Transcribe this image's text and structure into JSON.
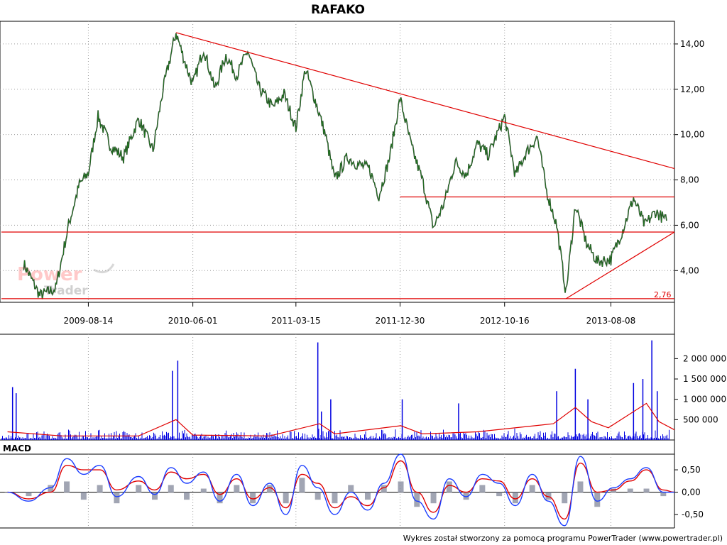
{
  "title": "RAFAKO",
  "footer": "Wykres został stworzony za pomocą programu PowerTrader (www.powertrader.pl)",
  "watermark": {
    "line1": "Power",
    "line2": "Trader"
  },
  "colors": {
    "price": "#1f7a1f",
    "trendline": "#e00000",
    "volume": "#0000e0",
    "volume_avg": "#e00000",
    "macd": "#1a3cff",
    "signal": "#e00000",
    "histogram": "#8a8fa0"
  },
  "price_panel": {
    "y_ticks": [
      "14,00",
      "12,00",
      "10,00",
      "8,00",
      "6,00",
      "4,00"
    ],
    "x_ticks": [
      "2009-08-14",
      "2010-06-01",
      "2011-03-15",
      "2011-12-30",
      "2012-10-16",
      "2013-08-08"
    ],
    "low_label": "2,76"
  },
  "volume_panel": {
    "y_ticks": [
      "2 000 000",
      "1 500 000",
      "1 000 000",
      "500 000"
    ]
  },
  "macd_panel": {
    "label": "MACD",
    "y_ticks": [
      "0,50",
      "0,00",
      "-0,50"
    ]
  },
  "chart_data": {
    "type": "line",
    "title": "RAFAKO",
    "price": {
      "ylim": [
        2.6,
        15.0
      ],
      "x": [
        "2009-02-15",
        "2009-04-01",
        "2009-05-15",
        "2009-06-20",
        "2009-07-20",
        "2009-08-14",
        "2009-09-10",
        "2009-10-15",
        "2009-11-20",
        "2010-01-01",
        "2010-02-10",
        "2010-03-10",
        "2010-04-15",
        "2010-05-10",
        "2010-06-01",
        "2010-07-01",
        "2010-08-01",
        "2010-09-01",
        "2010-10-01",
        "2010-11-01",
        "2010-12-01",
        "2011-01-10",
        "2011-02-10",
        "2011-03-15",
        "2011-04-10",
        "2011-05-10",
        "2011-06-05",
        "2011-07-01",
        "2011-08-05",
        "2011-09-01",
        "2011-10-05",
        "2011-11-01",
        "2011-12-01",
        "2011-12-30",
        "2012-02-01",
        "2012-03-01",
        "2012-04-01",
        "2012-05-01",
        "2012-06-01",
        "2012-07-01",
        "2012-08-01",
        "2012-09-01",
        "2012-10-16",
        "2012-11-15",
        "2012-12-15",
        "2013-01-15",
        "2013-02-10",
        "2013-03-10",
        "2013-04-05",
        "2013-05-01",
        "2013-06-01",
        "2013-07-01",
        "2013-08-08",
        "2013-09-10",
        "2013-10-10",
        "2013-11-10",
        "2013-12-10",
        "2014-01-10"
      ],
      "values": [
        4.3,
        2.9,
        3.2,
        6.0,
        7.8,
        8.3,
        10.8,
        9.5,
        9.0,
        10.7,
        9.3,
        12.0,
        14.5,
        13.2,
        12.2,
        13.8,
        12.0,
        13.5,
        12.6,
        13.7,
        12.1,
        11.2,
        11.8,
        10.3,
        12.9,
        11.4,
        10.0,
        8.0,
        9.0,
        8.7,
        8.5,
        7.3,
        9.0,
        11.6,
        9.4,
        8.0,
        5.9,
        7.0,
        8.8,
        8.2,
        9.6,
        9.1,
        10.8,
        8.2,
        9.2,
        9.9,
        7.5,
        6.0,
        3.0,
        6.9,
        5.2,
        4.4,
        4.5,
        5.8,
        7.2,
        6.0,
        6.6,
        6.2
      ]
    },
    "trendlines": [
      {
        "name": "descending",
        "x": [
          "2010-04-15",
          "2014-02-01"
        ],
        "y": [
          14.5,
          8.5
        ]
      },
      {
        "name": "resistance",
        "x": [
          "2011-12-30",
          "2014-02-01"
        ],
        "y": [
          7.25,
          7.25
        ]
      },
      {
        "name": "support",
        "x": [
          "2008-12-15",
          "2014-02-01"
        ],
        "y": [
          5.7,
          5.7
        ]
      },
      {
        "name": "rising",
        "x": [
          "2013-04-05",
          "2014-02-01"
        ],
        "y": [
          2.76,
          5.7
        ]
      },
      {
        "name": "low",
        "x": [
          "2008-12-15",
          "2014-02-01"
        ],
        "y": [
          2.76,
          2.76
        ]
      }
    ],
    "volume": {
      "ylim": [
        0,
        2600000
      ],
      "spikes": [
        {
          "x": "2009-01-15",
          "v": 1300000
        },
        {
          "x": "2009-01-25",
          "v": 1150000
        },
        {
          "x": "2010-04-05",
          "v": 1700000
        },
        {
          "x": "2010-04-20",
          "v": 1950000
        },
        {
          "x": "2011-05-15",
          "v": 2400000
        },
        {
          "x": "2011-05-25",
          "v": 700000
        },
        {
          "x": "2011-06-20",
          "v": 1000000
        },
        {
          "x": "2012-01-05",
          "v": 1000000
        },
        {
          "x": "2012-06-10",
          "v": 900000
        },
        {
          "x": "2013-03-10",
          "v": 1200000
        },
        {
          "x": "2013-05-01",
          "v": 1750000
        },
        {
          "x": "2013-06-05",
          "v": 1000000
        },
        {
          "x": "2013-10-10",
          "v": 1400000
        },
        {
          "x": "2013-11-05",
          "v": 1500000
        },
        {
          "x": "2013-11-30",
          "v": 2450000
        },
        {
          "x": "2013-12-15",
          "v": 1200000
        }
      ],
      "avg_x": [
        "2009-01-01",
        "2009-06-01",
        "2010-01-01",
        "2010-04-15",
        "2010-06-01",
        "2011-01-01",
        "2011-05-20",
        "2011-07-01",
        "2012-01-01",
        "2012-03-01",
        "2012-08-01",
        "2013-03-01",
        "2013-05-01",
        "2013-06-15",
        "2013-08-01",
        "2013-11-15",
        "2013-12-20",
        "2014-02-01"
      ],
      "avg_v": [
        200000,
        100000,
        100000,
        500000,
        120000,
        100000,
        400000,
        150000,
        350000,
        150000,
        200000,
        400000,
        800000,
        450000,
        300000,
        900000,
        450000,
        250000
      ]
    },
    "macd": {
      "ylim": [
        -0.8,
        0.85
      ],
      "x": [
        "2009-01-01",
        "2009-03-01",
        "2009-05-01",
        "2009-06-15",
        "2009-08-01",
        "2009-09-15",
        "2009-11-01",
        "2010-01-01",
        "2010-02-15",
        "2010-04-01",
        "2010-05-15",
        "2010-07-01",
        "2010-08-15",
        "2010-10-01",
        "2010-11-15",
        "2011-01-01",
        "2011-02-15",
        "2011-04-01",
        "2011-05-15",
        "2011-07-01",
        "2011-08-15",
        "2011-10-01",
        "2011-11-15",
        "2012-01-01",
        "2012-02-15",
        "2012-04-01",
        "2012-05-15",
        "2012-07-01",
        "2012-08-15",
        "2012-10-01",
        "2012-11-15",
        "2013-01-01",
        "2013-02-15",
        "2013-04-01",
        "2013-05-15",
        "2013-07-01",
        "2013-08-15",
        "2013-10-01",
        "2013-11-15",
        "2014-01-01",
        "2014-02-01"
      ],
      "macd": [
        0.0,
        -0.2,
        0.1,
        0.75,
        0.4,
        0.6,
        -0.1,
        0.35,
        -0.05,
        0.55,
        0.2,
        0.45,
        -0.2,
        0.4,
        -0.3,
        0.2,
        -0.5,
        0.6,
        0.1,
        -0.5,
        0.0,
        -0.4,
        0.2,
        0.85,
        -0.2,
        -0.6,
        0.3,
        -0.1,
        0.4,
        0.2,
        -0.3,
        0.4,
        -0.2,
        -0.75,
        0.8,
        -0.2,
        0.1,
        0.3,
        0.55,
        0.0,
        0.0
      ],
      "signal": [
        0.0,
        -0.15,
        0.0,
        0.6,
        0.5,
        0.5,
        0.05,
        0.25,
        0.05,
        0.45,
        0.3,
        0.4,
        -0.05,
        0.3,
        -0.15,
        0.1,
        -0.35,
        0.4,
        0.2,
        -0.35,
        -0.1,
        -0.3,
        0.1,
        0.7,
        0.0,
        -0.45,
        0.15,
        0.0,
        0.3,
        0.25,
        -0.15,
        0.3,
        -0.1,
        -0.6,
        0.65,
        0.0,
        0.05,
        0.25,
        0.5,
        0.05,
        0.0
      ]
    }
  }
}
